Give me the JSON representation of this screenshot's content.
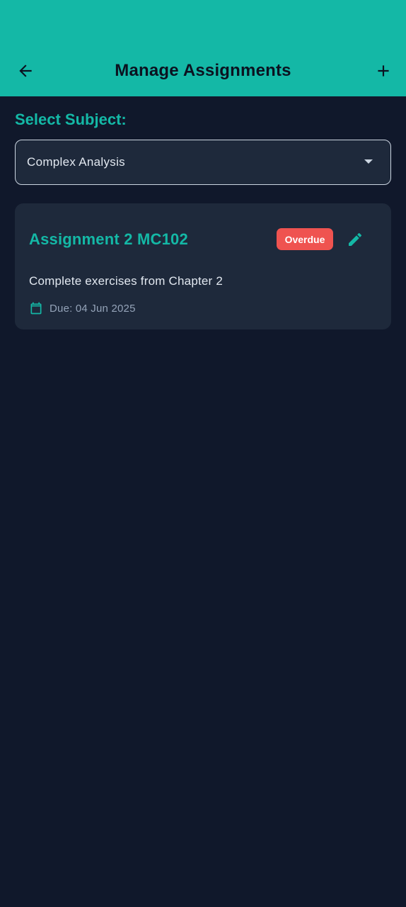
{
  "appbar": {
    "title": "Manage Assignments",
    "back_icon": "arrow-left-icon",
    "add_icon": "plus-icon",
    "color": "#14b8a6"
  },
  "subject": {
    "label": "Select Subject:",
    "selected": "Complex Analysis"
  },
  "assignments": [
    {
      "title": "Assignment 2 MC102",
      "status": "Overdue",
      "status_color": "#ef5350",
      "description": "Complete exercises from Chapter 2",
      "due": "Due: 04 Jun 2025",
      "edit_icon": "pencil-icon",
      "date_icon": "calendar-icon"
    }
  ],
  "colors": {
    "background": "#10182b",
    "card": "#1e293b",
    "accent": "#14b8a6"
  }
}
